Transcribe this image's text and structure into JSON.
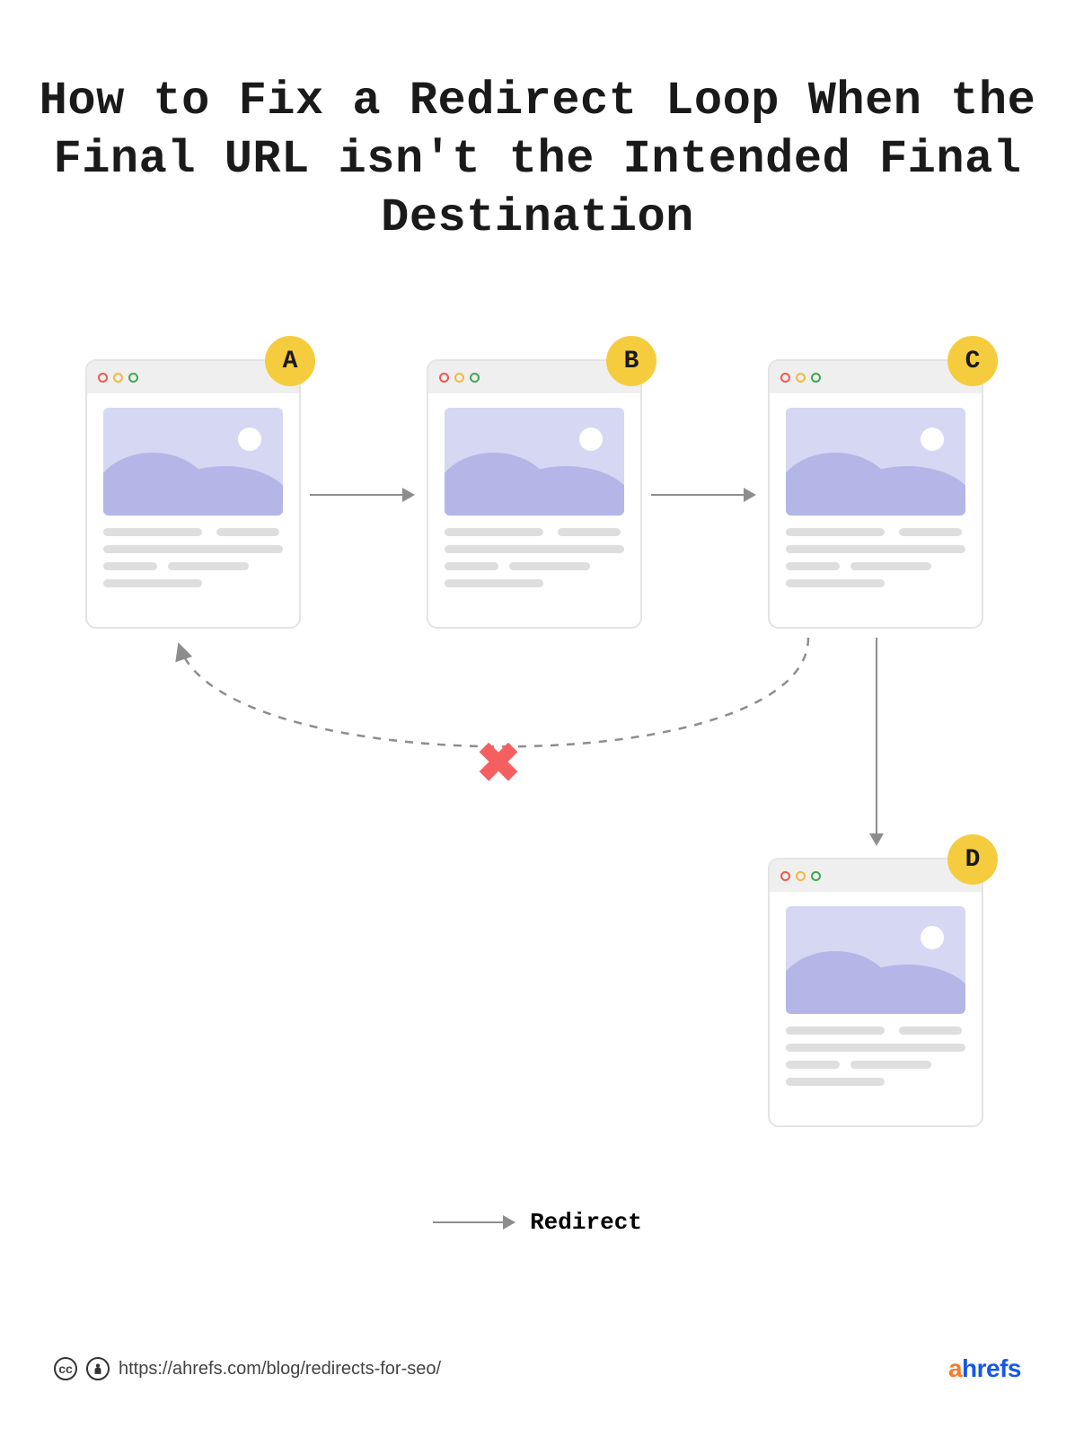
{
  "title": "How to Fix a Redirect Loop When the Final URL isn't the Intended Final Destination",
  "nodes": {
    "a": "A",
    "b": "B",
    "c": "C",
    "d": "D"
  },
  "legend_label": "Redirect",
  "broken_marker": "✖",
  "footer": {
    "url": "https://ahrefs.com/blog/redirects-for-seo/",
    "brand_a": "a",
    "brand_rest": "hrefs",
    "cc_label": "cc"
  },
  "colors": {
    "badge": "#f6cc3f",
    "cross": "#f55f5f",
    "arrow": "#8d8d8d"
  }
}
